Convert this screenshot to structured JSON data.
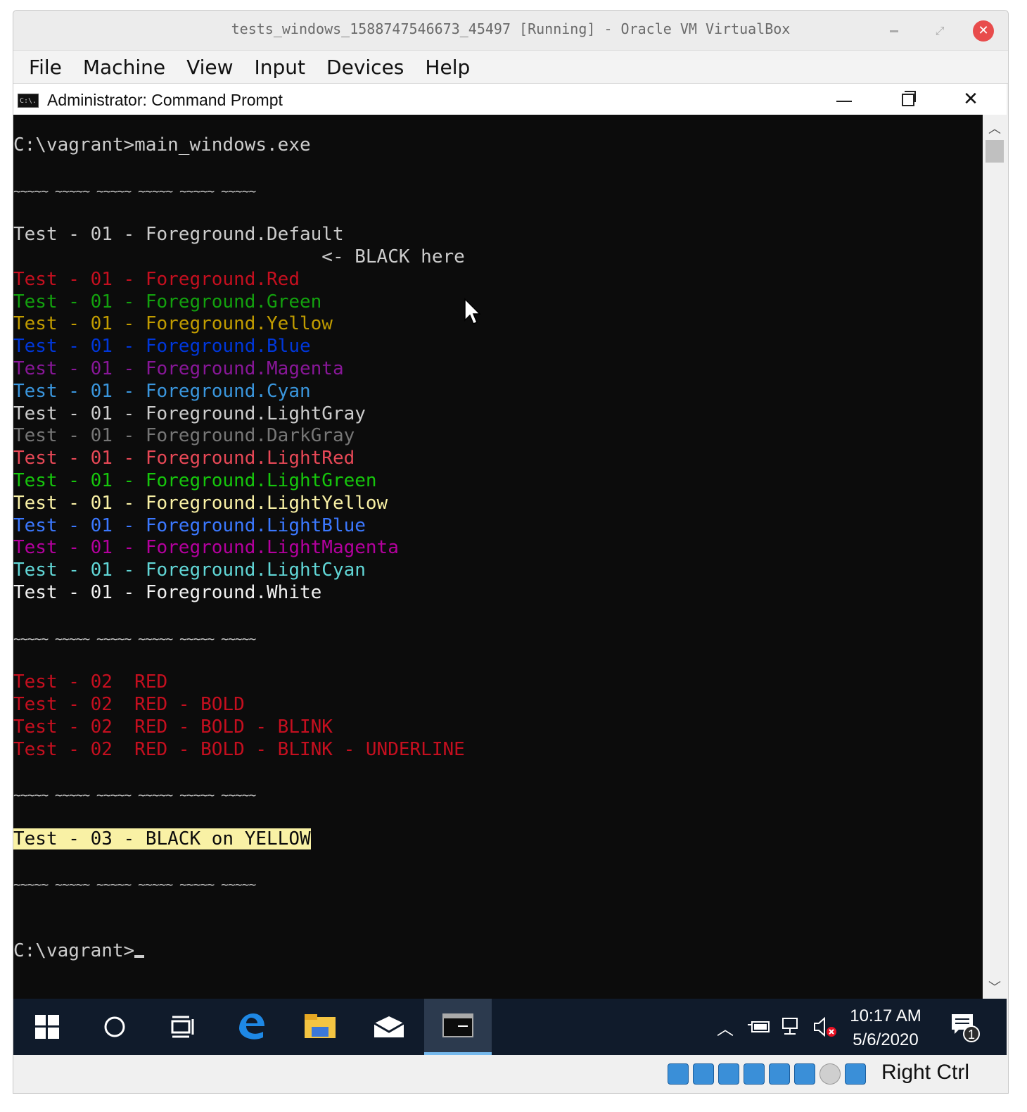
{
  "vm_window": {
    "title": "tests_windows_1588747546673_45497 [Running] - Oracle VM VirtualBox",
    "menu": [
      "File",
      "Machine",
      "View",
      "Input",
      "Devices",
      "Help"
    ]
  },
  "cmd_window": {
    "title": "Administrator: Command Prompt",
    "icon_text": "C:\\."
  },
  "console": {
    "lines": [
      {
        "text": "C:\\vagrant>main_windows.exe",
        "color": "#cccccc"
      },
      {
        "text": "",
        "color": "#cccccc"
      },
      {
        "text": "~~~~~ ~~~~~ ~~~~~ ~~~~~ ~~~~~ ~~~~~",
        "color": "#cccccc",
        "kind": "tilde"
      },
      {
        "text": "",
        "color": "#cccccc"
      },
      {
        "text": "Test - 01 - Foreground.Default",
        "color": "#cccccc"
      },
      {
        "text": "                            <- BLACK here",
        "color": "#cccccc"
      },
      {
        "text": "Test - 01 - Foreground.Red",
        "color": "#c50f1f"
      },
      {
        "text": "Test - 01 - Foreground.Green",
        "color": "#13a10e"
      },
      {
        "text": "Test - 01 - Foreground.Yellow",
        "color": "#c19c00"
      },
      {
        "text": "Test - 01 - Foreground.Blue",
        "color": "#0037da"
      },
      {
        "text": "Test - 01 - Foreground.Magenta",
        "color": "#881798"
      },
      {
        "text": "Test - 01 - Foreground.Cyan",
        "color": "#3a96dd"
      },
      {
        "text": "Test - 01 - Foreground.LightGray",
        "color": "#cccccc"
      },
      {
        "text": "Test - 01 - Foreground.DarkGray",
        "color": "#767676"
      },
      {
        "text": "Test - 01 - Foreground.LightRed",
        "color": "#e74856"
      },
      {
        "text": "Test - 01 - Foreground.LightGreen",
        "color": "#16c60c"
      },
      {
        "text": "Test - 01 - Foreground.LightYellow",
        "color": "#f9f1a5"
      },
      {
        "text": "Test - 01 - Foreground.LightBlue",
        "color": "#3b78ff"
      },
      {
        "text": "Test - 01 - Foreground.LightMagenta",
        "color": "#b4009e"
      },
      {
        "text": "Test - 01 - Foreground.LightCyan",
        "color": "#61d6d6"
      },
      {
        "text": "Test - 01 - Foreground.White",
        "color": "#f2f2f2"
      },
      {
        "text": "",
        "color": "#cccccc"
      },
      {
        "text": "~~~~~ ~~~~~ ~~~~~ ~~~~~ ~~~~~ ~~~~~",
        "color": "#cccccc",
        "kind": "tilde"
      },
      {
        "text": "",
        "color": "#cccccc"
      },
      {
        "text": "Test - 02  RED",
        "color": "#c50f1f"
      },
      {
        "text": "Test - 02  RED - BOLD",
        "color": "#c50f1f"
      },
      {
        "text": "Test - 02  RED - BOLD - BLINK",
        "color": "#c50f1f"
      },
      {
        "text": "Test - 02  RED - BOLD - BLINK - UNDERLINE",
        "color": "#c50f1f"
      },
      {
        "text": "",
        "color": "#cccccc"
      },
      {
        "text": "~~~~~ ~~~~~ ~~~~~ ~~~~~ ~~~~~ ~~~~~",
        "color": "#cccccc",
        "kind": "tilde"
      },
      {
        "text": "",
        "color": "#cccccc"
      },
      {
        "text": "Test - 03 - BLACK on YELLOW",
        "color": "#0c0c0c",
        "kind": "highlight"
      },
      {
        "text": "",
        "color": "#cccccc"
      },
      {
        "text": "~~~~~ ~~~~~ ~~~~~ ~~~~~ ~~~~~ ~~~~~",
        "color": "#cccccc",
        "kind": "tilde"
      },
      {
        "text": "",
        "color": "#cccccc"
      },
      {
        "text": "",
        "color": "#cccccc"
      },
      {
        "text": "C:\\vagrant>",
        "color": "#cccccc",
        "kind": "prompt"
      }
    ]
  },
  "taskbar": {
    "clock_time": "10:17 AM",
    "clock_date": "5/6/2020",
    "notification_count": "1"
  },
  "status_bar": {
    "host_key": "Right Ctrl"
  }
}
